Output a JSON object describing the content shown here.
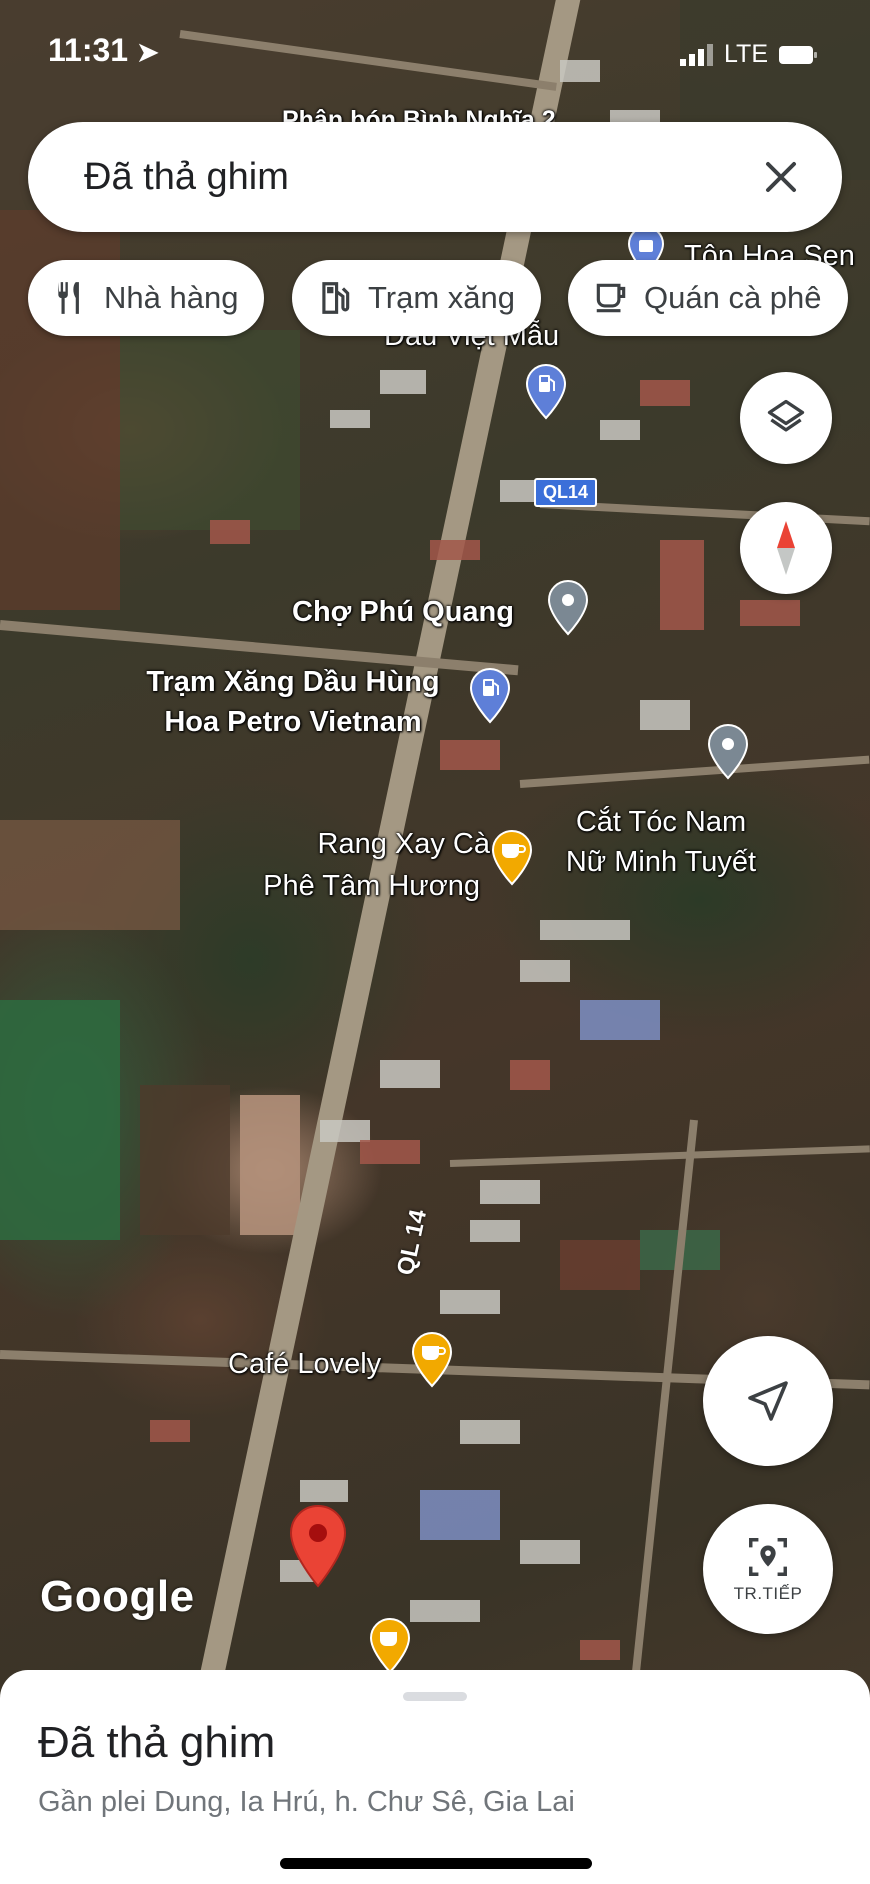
{
  "status_bar": {
    "time": "11:31",
    "network": "LTE"
  },
  "search": {
    "title": "Đã thả ghim"
  },
  "chips": [
    {
      "label": "Nhà hàng",
      "icon": "restaurant-icon"
    },
    {
      "label": "Trạm xăng",
      "icon": "gas-station-icon"
    },
    {
      "label": "Quán cà phê",
      "icon": "coffee-icon"
    }
  ],
  "map": {
    "road_labels": {
      "ql14_shield": "QL14",
      "ql14_vertical": "QL 14"
    },
    "places": {
      "top_cut": "Phân bón Bình Nghĩa 2",
      "ton_hoa_sen": "Tôn Hoa Sen",
      "dau_viet_mau": "Dầu Việt Mẫu",
      "cho_phu_quang": "Chợ Phú Quang",
      "tram_xang_1": "Trạm Xăng Dầu Hùng",
      "tram_xang_2": "Hoa Petro Vietnam",
      "rang_xay_1": "Rang Xay Cà",
      "rang_xay_2": "Phê Tâm Hương",
      "cat_toc_1": "Cắt Tóc Nam",
      "cat_toc_2": "Nữ Minh Tuyết",
      "cafe_lovely": "Café Lovely"
    },
    "logo": "Google"
  },
  "buttons": {
    "live_view": "TR.TIẾP"
  },
  "sheet": {
    "title": "Đã thả ghim",
    "subtitle": "Gần plei Dung, Ia Hrú, h. Chư Sê, Gia Lai"
  },
  "colors": {
    "pin_red": "#ea4335",
    "coffee_pin": "#f2a900",
    "gas_pin": "#5e7fd8",
    "generic_pin": "#7b8893"
  }
}
